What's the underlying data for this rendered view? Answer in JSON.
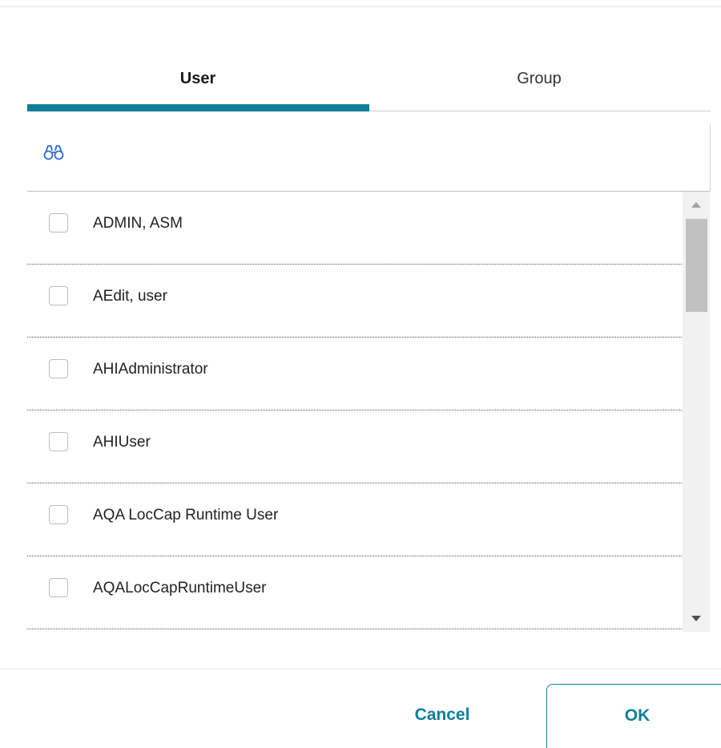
{
  "tabs": [
    {
      "label": "User",
      "selected": true
    },
    {
      "label": "Group",
      "selected": false
    }
  ],
  "search": {
    "icon": "binoculars-icon"
  },
  "users": [
    {
      "label": "ADMIN, ASM",
      "checked": false
    },
    {
      "label": "AEdit, user",
      "checked": false
    },
    {
      "label": "AHIAdministrator",
      "checked": false
    },
    {
      "label": "AHIUser",
      "checked": false
    },
    {
      "label": "AQA LocCap Runtime User",
      "checked": false
    },
    {
      "label": "AQALocCapRuntimeUser",
      "checked": false
    }
  ],
  "buttons": {
    "cancel_label": "Cancel",
    "ok_label": "OK"
  },
  "colors": {
    "accent": "#0d7f9c",
    "icon_blue": "#2f6fd6"
  }
}
